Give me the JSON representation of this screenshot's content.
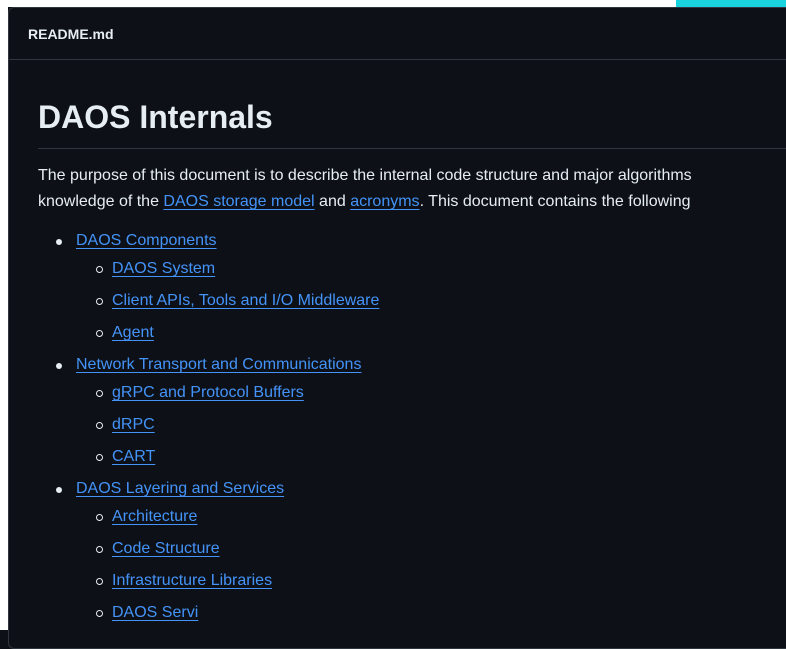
{
  "file_header": {
    "title": "README.md"
  },
  "doc": {
    "title": "DAOS Internals",
    "intro_part1": "The purpose of this document is to describe the internal code structure and major algorithms",
    "intro_part2": "knowledge of the ",
    "link_storage_model": "DAOS storage model",
    "intro_and": " and ",
    "link_acronyms": "acronyms",
    "intro_part3": ". This document contains the following"
  },
  "toc": [
    {
      "label": "DAOS Components",
      "children": [
        "DAOS System",
        "Client APIs, Tools and I/O Middleware",
        "Agent"
      ]
    },
    {
      "label": "Network Transport and Communications",
      "children": [
        "gRPC and Protocol Buffers",
        "dRPC",
        "CART"
      ]
    },
    {
      "label": "DAOS Layering and Services",
      "children": [
        "Architecture",
        "Code Structure",
        "Infrastructure Libraries",
        "DAOS Servi"
      ]
    }
  ],
  "colors": {
    "background": "#0d1117",
    "text": "#e6edf3",
    "link": "#4493f8",
    "border": "#30363d",
    "accent": "#19d3de"
  }
}
